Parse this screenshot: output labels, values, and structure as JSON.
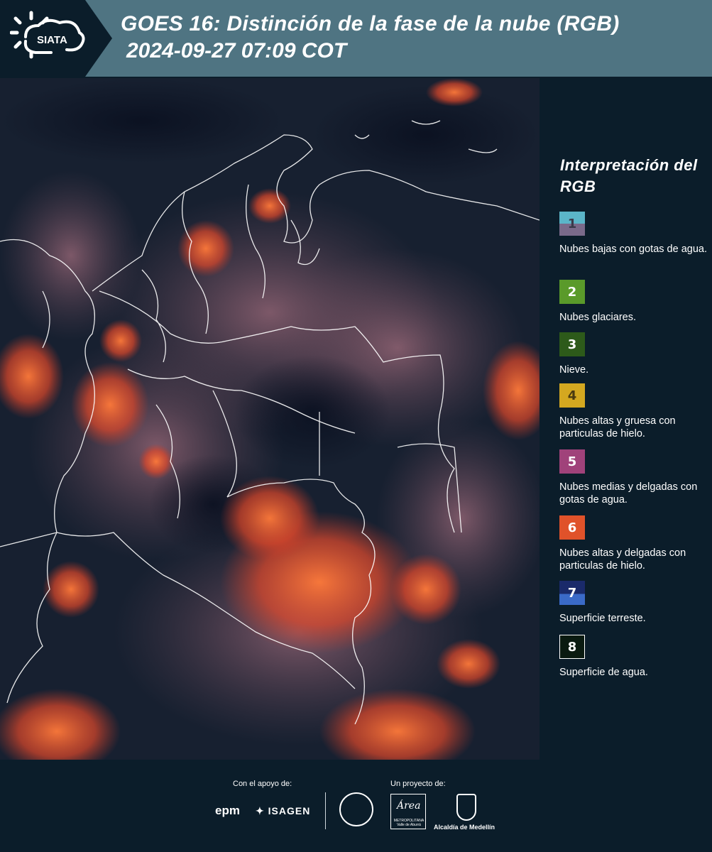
{
  "header": {
    "logo_text": "SIATA",
    "title": "GOES 16: Distinción de la fase de la nube (RGB)",
    "subtitle": "2024-09-27 07:09 COT"
  },
  "legend": {
    "title": "Interpretación del RGB",
    "items": [
      {
        "number": "1",
        "label": "Nubes bajas con gotas de agua.",
        "color_top": "#5bb5c8",
        "color_bottom": "#7a6a8a",
        "text_color": "#3a3a4a"
      },
      {
        "number": "2",
        "label": "Nubes glaciares.",
        "color_top": "#5a9a2a",
        "text_color": "#ffffff"
      },
      {
        "number": "3",
        "label": "Nieve.",
        "color_top": "#2d5a1a",
        "text_color": "#ffffff"
      },
      {
        "number": "4",
        "label": "Nubes altas y gruesa con particulas de hielo.",
        "color_top": "#d4a820",
        "text_color": "#4a3a10"
      },
      {
        "number": "5",
        "label": "Nubes medias y delgadas con gotas de agua.",
        "color_top": "#a0427a",
        "text_color": "#ffffff"
      },
      {
        "number": "6",
        "label": "Nubes altas y delgadas con particulas de hielo.",
        "color_top": "#e0522a",
        "text_color": "#ffffff"
      },
      {
        "number": "7",
        "label": "Superficie terreste.",
        "color_top": "#1a2a6a",
        "color_bottom": "#3a6ac8",
        "text_color": "#ffffff"
      },
      {
        "number": "8",
        "label": "Superficie de agua.",
        "color_top": "#0a1a10",
        "text_color": "#ffffff",
        "border": "#ffffff"
      }
    ]
  },
  "footer": {
    "support_label": "Con el apoyo de:",
    "project_label": "Un proyecto de:",
    "epm": "epm",
    "isagen": "ISAGEN",
    "amva": "METROPOLITANA Valle de Aburrá",
    "amva_title": "Área",
    "alcaldia": "Alcaldía de Medellín"
  },
  "colors": {
    "background": "#0b1d2a",
    "header_band": "#4f7482",
    "cloud_orange": "#e8502a",
    "cloud_pink": "#8a5a6a"
  }
}
